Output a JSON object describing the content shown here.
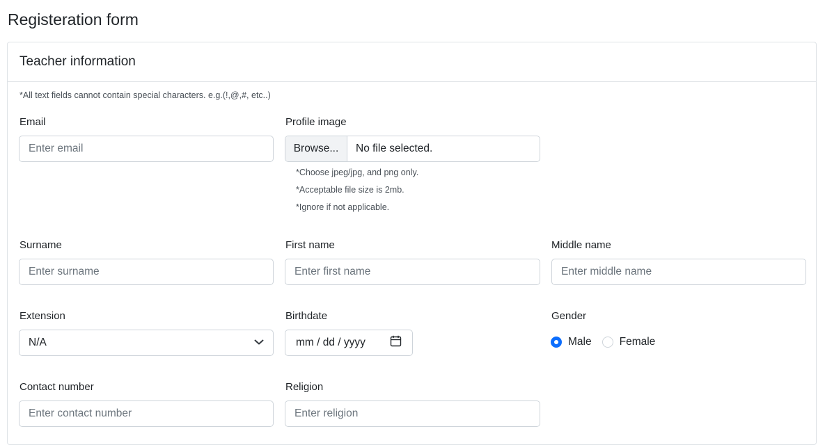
{
  "page_title": "Registeration form",
  "card": {
    "title": "Teacher information",
    "note": "*All text fields cannot contain special characters. e.g.(!,@,#, etc..)"
  },
  "email": {
    "label": "Email",
    "placeholder": "Enter email"
  },
  "profile_image": {
    "label": "Profile image",
    "browse_label": "Browse...",
    "file_status": "No file selected.",
    "hints": [
      "*Choose jpeg/jpg, and png only.",
      "*Acceptable file size is 2mb.",
      "*Ignore if not applicable."
    ]
  },
  "surname": {
    "label": "Surname",
    "placeholder": "Enter surname"
  },
  "first_name": {
    "label": "First name",
    "placeholder": "Enter first name"
  },
  "middle_name": {
    "label": "Middle name",
    "placeholder": "Enter middle name"
  },
  "extension": {
    "label": "Extension",
    "value": "N/A"
  },
  "birthdate": {
    "label": "Birthdate",
    "placeholder": "mm / dd / yyyy"
  },
  "gender": {
    "label": "Gender",
    "options": [
      "Male",
      "Female"
    ],
    "selected": "Male"
  },
  "contact_number": {
    "label": "Contact number",
    "placeholder": "Enter contact number"
  },
  "religion": {
    "label": "Religion",
    "placeholder": "Enter religion"
  },
  "colors": {
    "accent": "#0d6efd",
    "border": "#ced4da"
  }
}
